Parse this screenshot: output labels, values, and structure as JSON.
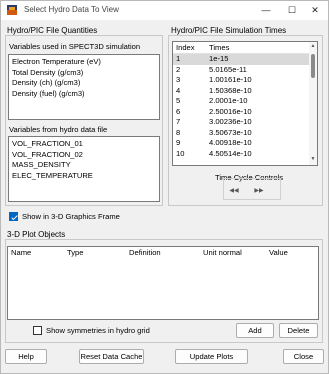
{
  "window": {
    "title": "Select Hydro Data To View",
    "controls": {
      "minimize": "—",
      "maximize": "☐",
      "close": "✕"
    }
  },
  "hydro_quantities": {
    "group_title": "Hydro/PIC File Quantities",
    "spect3d_label": "Variables used in SPECT3D simulation",
    "spect3d_vars": [
      "Electron Temperature (eV)",
      "Total Density (g/cm3)",
      "Density (ch) (g/cm3)",
      "Density (fuel) (g/cm3)"
    ],
    "hydro_label": "Variables from hydro data file",
    "hydro_vars": [
      "VOL_FRACTION_01",
      "VOL_FRACTION_02",
      "MASS_DENSITY",
      "ELEC_TEMPERATURE"
    ]
  },
  "sim_times": {
    "group_title": "Hydro/PIC File Simulation Times",
    "columns": {
      "index": "Index",
      "times": "Times"
    },
    "rows": [
      {
        "index": "1",
        "time": "1e-15"
      },
      {
        "index": "2",
        "time": "5.0165e-11"
      },
      {
        "index": "3",
        "time": "1.00161e-10"
      },
      {
        "index": "4",
        "time": "1.50368e-10"
      },
      {
        "index": "5",
        "time": "2.0001e-10"
      },
      {
        "index": "6",
        "time": "2.50016e-10"
      },
      {
        "index": "7",
        "time": "3.00236e-10"
      },
      {
        "index": "8",
        "time": "3.50673e-10"
      },
      {
        "index": "9",
        "time": "4.00918e-10"
      },
      {
        "index": "10",
        "time": "4.50514e-10"
      }
    ],
    "selected_index": "1",
    "time_cycle_label": "Time Cycle Controls",
    "prev_symbol": "◀◀",
    "next_symbol": "▶▶"
  },
  "show_3d": {
    "label": "Show in 3-D Graphics Frame",
    "checked": true
  },
  "plot_objects": {
    "group_title": "3-D Plot Objects",
    "columns": [
      "Name",
      "Type",
      "Definition",
      "Unit normal",
      "Value"
    ],
    "show_symmetries_label": "Show symmetries in hydro grid",
    "show_symmetries_checked": false,
    "add_label": "Add",
    "delete_label": "Delete"
  },
  "bottom_buttons": {
    "help": "Help",
    "reset": "Reset Data Cache",
    "update": "Update Plots",
    "close": "Close"
  },
  "colors": {
    "selected_row": "#d9d9d9",
    "checkbox_checked": "#0067c0",
    "window_bg": "#f0f0f0"
  }
}
